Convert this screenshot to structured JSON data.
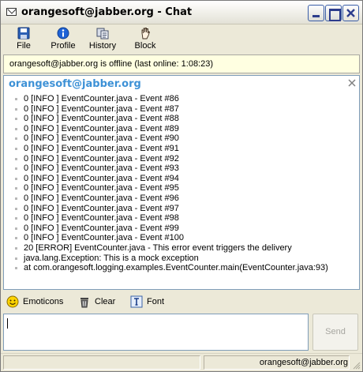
{
  "window": {
    "title": "orangesoft@jabber.org - Chat"
  },
  "toolbar": {
    "file_label": "File",
    "profile_label": "Profile",
    "history_label": "History",
    "block_label": "Block"
  },
  "status_strip": {
    "text": "orangesoft@jabber.org is offline (last online: 1:08:23)"
  },
  "chat": {
    "sender": "orangesoft@jabber.org",
    "messages": [
      "0 [INFO ] EventCounter.java - Event #86",
      "0 [INFO ] EventCounter.java - Event #87",
      "0 [INFO ] EventCounter.java - Event #88",
      "0 [INFO ] EventCounter.java - Event #89",
      "0 [INFO ] EventCounter.java - Event #90",
      "0 [INFO ] EventCounter.java - Event #91",
      "0 [INFO ] EventCounter.java - Event #92",
      "0 [INFO ] EventCounter.java - Event #93",
      "0 [INFO ] EventCounter.java - Event #94",
      "0 [INFO ] EventCounter.java - Event #95",
      "0 [INFO ] EventCounter.java - Event #96",
      "0 [INFO ] EventCounter.java - Event #97",
      "0 [INFO ] EventCounter.java - Event #98",
      "0 [INFO ] EventCounter.java - Event #99",
      "0 [INFO ] EventCounter.java - Event #100",
      "20 [ERROR] EventCounter.java - This error event triggers the delivery",
      "java.lang.Exception: This is a mock exception",
      "at com.orangesoft.logging.examples.EventCounter.main(EventCounter.java:93)"
    ]
  },
  "actions": {
    "emoticons_label": "Emoticons",
    "clear_label": "Clear",
    "font_label": "Font"
  },
  "input": {
    "value": "",
    "send_label": "Send"
  },
  "statusbar": {
    "left_text": "",
    "account": "orangesoft@jabber.org"
  },
  "colors": {
    "sender": "#3d91d6",
    "status_strip_bg": "#ffffe1",
    "window_bg": "#ece9d8"
  }
}
